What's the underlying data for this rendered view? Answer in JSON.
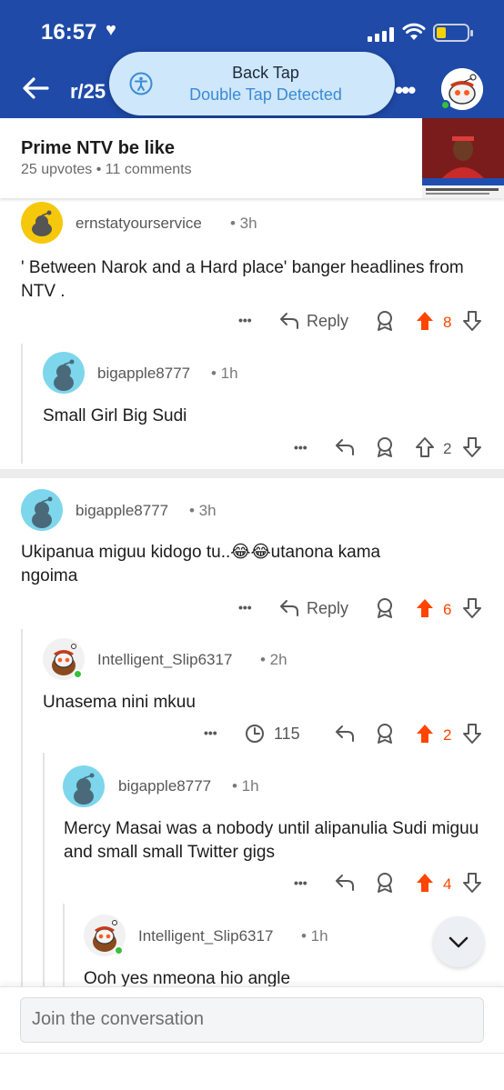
{
  "status_bar": {
    "time": "16:57",
    "heart": "♥"
  },
  "header": {
    "subreddit": "r/25",
    "more": "•••"
  },
  "back_tap": {
    "title": "Back Tap",
    "subtitle": "Double Tap Detected"
  },
  "post": {
    "title": "Prime NTV be like",
    "meta": "25 upvotes • 11 comments"
  },
  "comments": [
    {
      "username": "ernstatyourservice",
      "time": "• 3h",
      "text": "' Between Narok and a Hard place' banger headlines from NTV .",
      "more": "•••",
      "reply": "Reply",
      "votes": "8"
    },
    {
      "username": "bigapple8777",
      "time": "• 1h",
      "text": "Small Girl Big Sudi",
      "more": "•••",
      "votes": "2"
    },
    {
      "username": "bigapple8777",
      "time": "• 3h",
      "text_before": "Ukipanua miguu kidogo tu..",
      "emoji": "😂😂",
      "text_after": "utanona kama",
      "text_line2": "ngoima",
      "more": "•••",
      "reply": "Reply",
      "votes": "6"
    },
    {
      "username": "Intelligent_Slip6317",
      "time": "• 2h",
      "text": "Unasema nini mkuu",
      "more": "•••",
      "views": "115",
      "votes": "2"
    },
    {
      "username": "bigapple8777",
      "time": "• 1h",
      "text": "Mercy Masai was a nobody until alipanulia Sudi miguu and small small Twitter gigs",
      "more": "•••",
      "votes": "4"
    },
    {
      "username": "Intelligent_Slip6317",
      "time": "• 1h",
      "text": "Ooh yes nmeona hio angle"
    }
  ],
  "composer": {
    "placeholder": "Join the conversation"
  },
  "icons": {
    "back": "back-arrow-icon",
    "accessibility": "accessibility-icon",
    "more": "more-dots-icon",
    "reply": "reply-arrow-icon",
    "award": "award-icon",
    "upvote": "upvote-arrow-icon",
    "downvote": "downvote-arrow-icon",
    "views": "views-clock-icon",
    "scroll": "chevron-down-icon"
  },
  "colors": {
    "header": "#1f4aa8",
    "upvote_active": "#ff4500",
    "pill": "#cfe7fa",
    "pill_sub": "#3a8bd6"
  }
}
